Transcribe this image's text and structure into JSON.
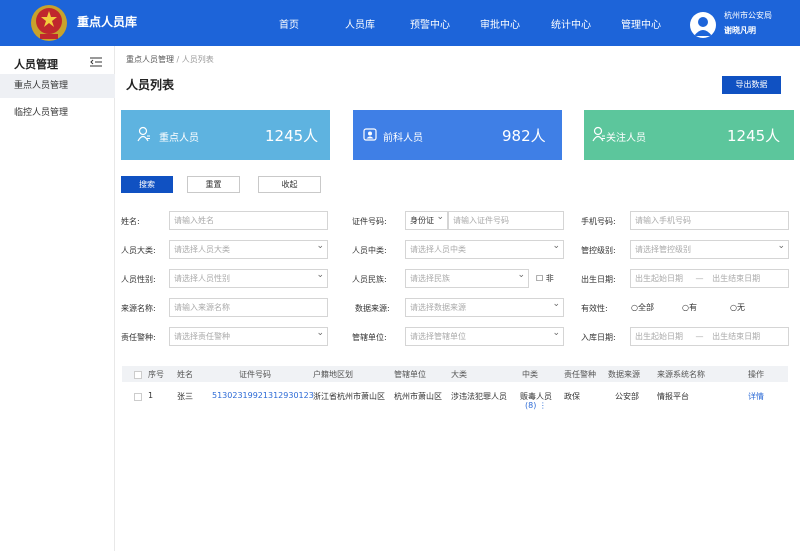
{
  "header": {
    "title": "重点人员库",
    "nav": [
      "首页",
      "人员库",
      "预警中心",
      "审批中心",
      "统计中心",
      "管理中心"
    ],
    "org": "杭州市公安局",
    "user": "谢晓凡明"
  },
  "sidebar": {
    "title": "人员管理",
    "items": [
      {
        "label": "重点人员管理",
        "active": true
      },
      {
        "label": "临控人员管理",
        "active": false
      }
    ]
  },
  "breadcrumb": {
    "parent": "重点人员管理",
    "sep": " / ",
    "current": "人员列表"
  },
  "page_title": "人员列表",
  "export_label": "导出数据",
  "cards": [
    {
      "label": "重点人员",
      "value": "1245人",
      "color": "#5eb3e0",
      "icon": "user-icon"
    },
    {
      "label": "前科人员",
      "value": "982人",
      "color": "#3f7fe6",
      "icon": "id-badge-icon"
    },
    {
      "label": "关注人员",
      "value": "1245人",
      "color": "#5cc69c",
      "icon": "user-icon"
    }
  ],
  "actions": {
    "search": "搜索",
    "reset": "重置",
    "collapse": "收起"
  },
  "filters": {
    "name": {
      "label": "姓名:",
      "placeholder": "请输入姓名"
    },
    "id_no": {
      "label": "证件号码:",
      "type_value": "身份证",
      "placeholder": "请输入证件号码"
    },
    "phone": {
      "label": "手机号码:",
      "placeholder": "请输入手机号码"
    },
    "category_major": {
      "label": "人员大类:",
      "placeholder": "请选择人员大类"
    },
    "category_mid": {
      "label": "人员中类:",
      "placeholder": "请选择人员中类"
    },
    "control_level": {
      "label": "管控级别:",
      "placeholder": "请选择管控级别"
    },
    "gender": {
      "label": "人员性别:",
      "placeholder": "请选择人员性别"
    },
    "ethnicity": {
      "label": "人员民族:",
      "placeholder": "请选择民族",
      "not_label": "非"
    },
    "birth_date": {
      "label": "出生日期:",
      "start": "出生起始日期",
      "sep": "—",
      "end": "出生结束日期"
    },
    "source_name": {
      "label": "来源名称:",
      "placeholder": "请输入来源名称"
    },
    "data_source": {
      "label": "数据来源:",
      "placeholder": "请选择数据来源"
    },
    "validity": {
      "label": "有效性:",
      "options": [
        "全部",
        "有",
        "无"
      ]
    },
    "police": {
      "label": "责任警种:",
      "placeholder": "请选择责任警种"
    },
    "unit": {
      "label": "管辖单位:",
      "placeholder": "请选择管辖单位"
    },
    "entry_date": {
      "label": "入库日期:",
      "start": "出生起始日期",
      "sep": "—",
      "end": "出生结束日期"
    }
  },
  "table": {
    "columns": [
      "序号",
      "姓名",
      "证件号码",
      "户籍地区划",
      "管辖单位",
      "大类",
      "中类",
      "责任警种",
      "数据来源",
      "来源系统名称",
      "操作"
    ],
    "rows": [
      {
        "index": "1",
        "name": "张三",
        "id_no": "513023199213129301​23",
        "residence": "浙江省杭州市萧山区",
        "unit": "杭州市萧山区",
        "major": "涉违法犯罪人员",
        "mid": "贩毒人员",
        "mid_count": "(8)",
        "police": "政保",
        "source": "公安部",
        "system": "情报平台",
        "action": "详情"
      }
    ]
  },
  "colors": {
    "header": "#1d64d9",
    "primary": "#1051c2",
    "link": "#2d6bd6"
  }
}
